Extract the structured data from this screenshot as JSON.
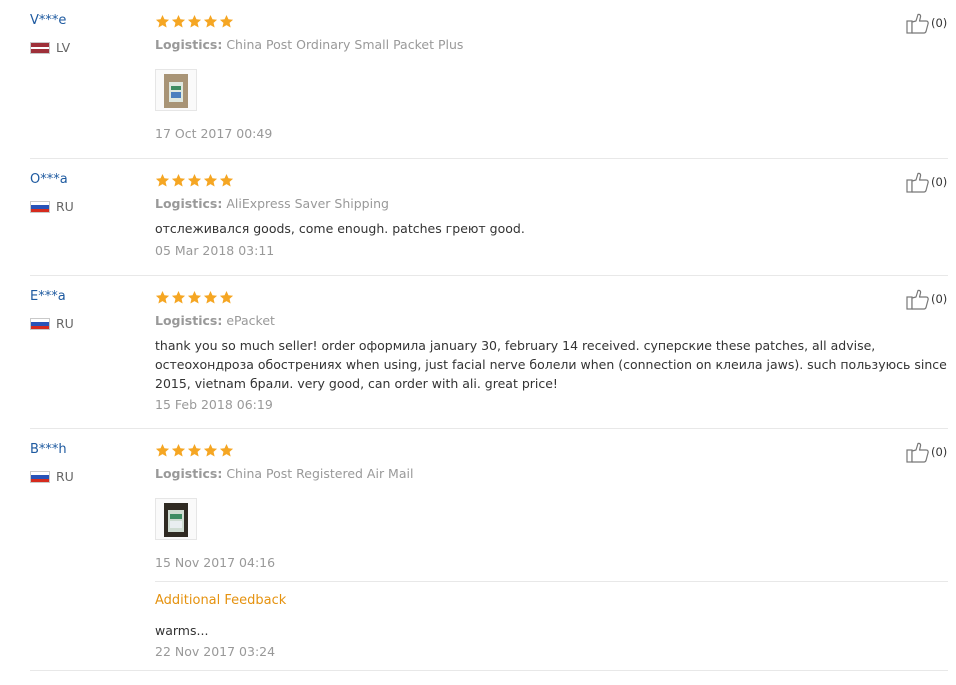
{
  "colors": {
    "star": "#f5a623",
    "buyer_name": "#1e5aa0",
    "additional_title": "#e5920f"
  },
  "logistics_label": "Logistics:",
  "reviews": [
    {
      "buyer": "V***e",
      "country": "LV",
      "flag": "lv-flag-icon",
      "stars": 5,
      "logistics": "China Post Ordinary Small Packet Plus",
      "photo": "product-photo",
      "date": "17 Oct 2017 00:49",
      "likes": "(0)"
    },
    {
      "buyer": "O***a",
      "country": "RU",
      "flag": "ru-flag-icon",
      "stars": 5,
      "logistics": "AliExpress Saver Shipping",
      "text": "отслеживался goods, come enough. patches греют good.",
      "date": "05 Mar 2018 03:11",
      "likes": "(0)"
    },
    {
      "buyer": "E***a",
      "country": "RU",
      "flag": "ru-flag-icon",
      "stars": 5,
      "logistics": "ePacket",
      "text": "thank you so much seller! order оформила january 30, february 14 received. суперские these patches, all advise, остеохондроза обострениях when using, just facial nerve болели when (connection on клеила jaws). such пользуюсь since 2015, vietnam брали. very good, can order with ali. great price!",
      "date": "15 Feb 2018 06:19",
      "likes": "(0)"
    },
    {
      "buyer": "B***h",
      "country": "RU",
      "flag": "ru-flag-icon",
      "stars": 5,
      "logistics": "China Post Registered Air Mail",
      "photo": "product-photo",
      "date": "15 Nov 2017 04:16",
      "likes": "(0)",
      "additional": {
        "title": "Additional Feedback",
        "text": "warms...",
        "date": "22 Nov 2017 03:24"
      }
    }
  ]
}
